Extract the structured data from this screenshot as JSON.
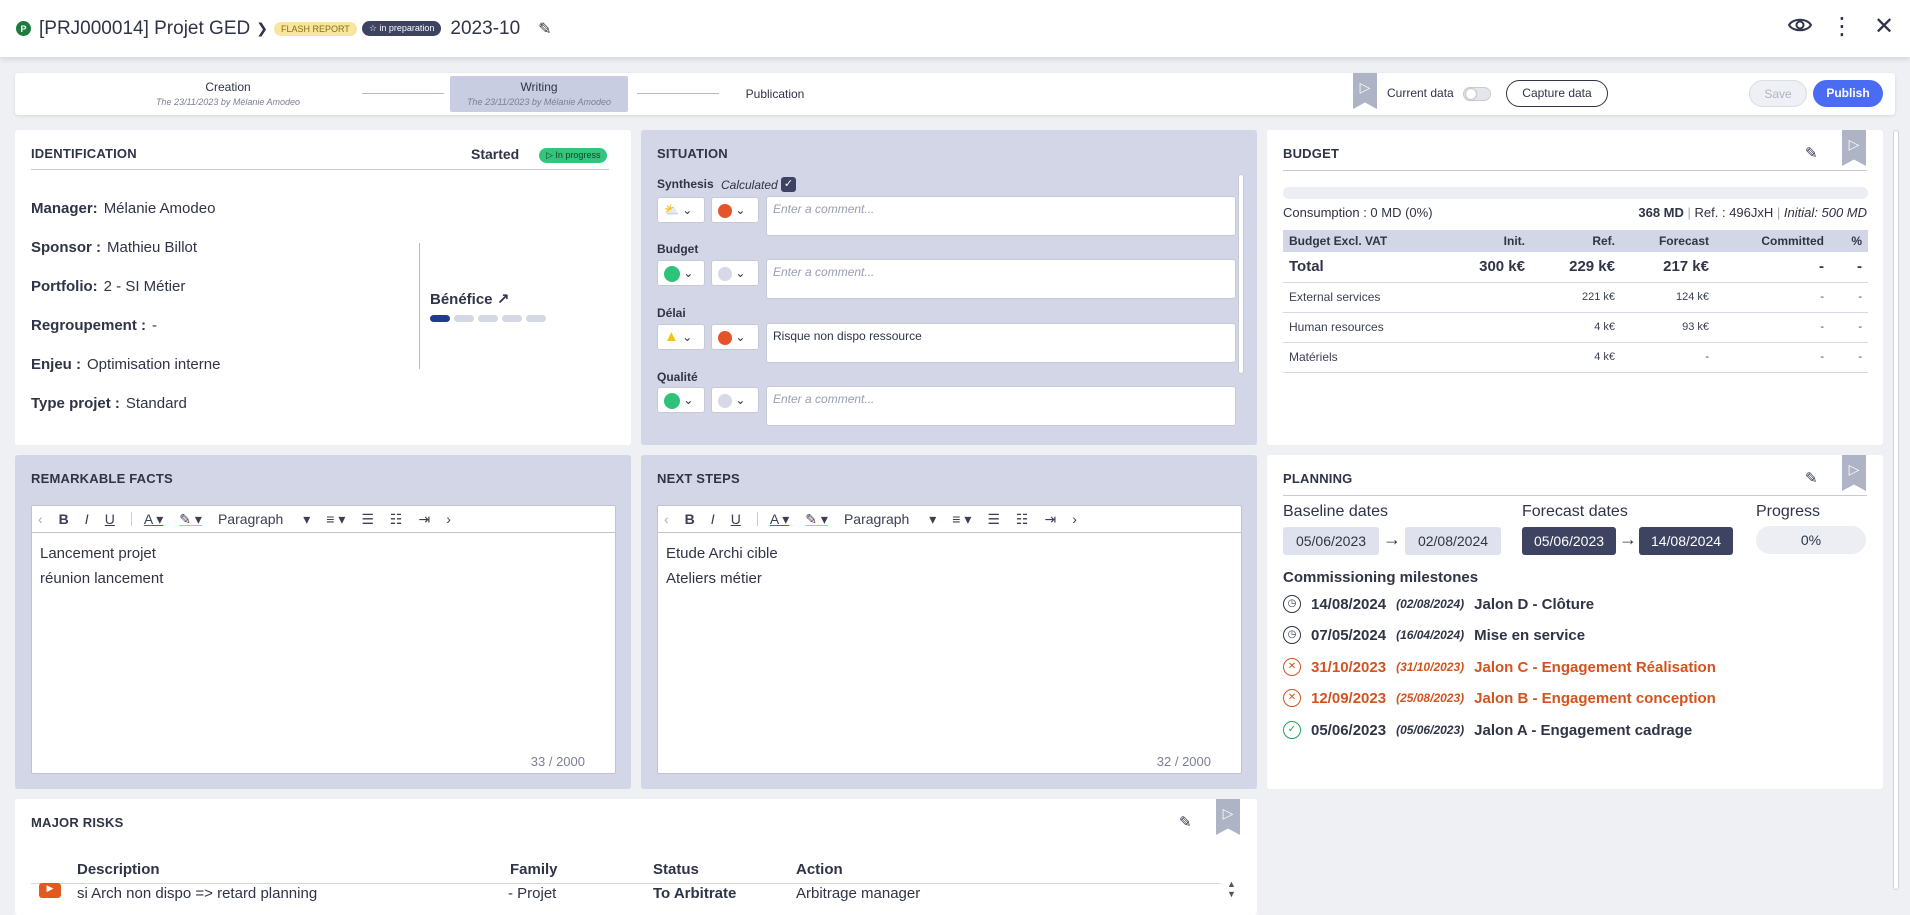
{
  "header": {
    "project_code": "[PRJ000014] Projet GED",
    "badge_flash": "FLASH REPORT",
    "badge_status": "☆ in preparation",
    "period": "2023-10",
    "p_letter": "P"
  },
  "workflow": {
    "steps": [
      {
        "name": "Creation",
        "date": "The 23/11/2023 by Mélanie Amodeo"
      },
      {
        "name": "Writing",
        "date": "The 23/11/2023 by Mélanie Amodeo"
      },
      {
        "name": "Publication",
        "date": ""
      }
    ],
    "current_data_label": "Current data",
    "capture_label": "Capture data",
    "save_label": "Save",
    "publish_label": "Publish"
  },
  "identification": {
    "title": "IDENTIFICATION",
    "state": "Started",
    "state_badge": "▷ In progress",
    "fields": [
      {
        "label": "Manager:",
        "value": "Mélanie Amodeo"
      },
      {
        "label": "Sponsor :",
        "value": "Mathieu Billot"
      },
      {
        "label": "Portfolio:",
        "value": "2 - SI Métier"
      },
      {
        "label": "Regroupement :",
        "value": "-"
      },
      {
        "label": "Enjeu :",
        "value": "Optimisation interne"
      },
      {
        "label": "Type projet :",
        "value": "Standard"
      }
    ],
    "benefit_label": "Bénéfice",
    "benefit_level": 1,
    "benefit_max": 5
  },
  "situation": {
    "title": "SITUATION",
    "synthesis_label": "Synthesis",
    "calculated_label": "Calculated",
    "rows": [
      {
        "label": "Budget",
        "comment": "",
        "placeholder": "Enter a comment..."
      },
      {
        "label": "Délai",
        "comment": "Risque non dispo ressource",
        "placeholder": "Enter a comment..."
      },
      {
        "label": "Qualité",
        "comment": "",
        "placeholder": "Enter a comment..."
      }
    ],
    "synthesis_placeholder": "Enter a comment..."
  },
  "budget": {
    "title": "BUDGET",
    "consumption": "Consumption : 0 MD (0%)",
    "md": "368 MD",
    "ref": "Ref. : 496JxH",
    "initial": "Initial: 500 MD",
    "columns": [
      "Budget Excl. VAT",
      "Init.",
      "Ref.",
      "Forecast",
      "Committed",
      "%"
    ],
    "rows": [
      [
        "Total",
        "300 k€",
        "229 k€",
        "217 k€",
        "-",
        "-"
      ],
      [
        "External services",
        "",
        "221 k€",
        "124 k€",
        "-",
        "-"
      ],
      [
        "Human resources",
        "",
        "4 k€",
        "93 k€",
        "-",
        "-"
      ],
      [
        "Matériels",
        "",
        "4 k€",
        "-",
        "-",
        "-"
      ]
    ]
  },
  "facts": {
    "title": "REMARKABLE FACTS",
    "lines": [
      "Lancement projet",
      "réunion lancement"
    ],
    "count": "33 / 2000",
    "paragraph": "Paragraph"
  },
  "next_steps": {
    "title": "NEXT STEPS",
    "lines": [
      "Etude Archi cible",
      "Ateliers métier"
    ],
    "count": "32 / 2000",
    "paragraph": "Paragraph"
  },
  "planning": {
    "title": "PLANNING",
    "baseline_label": "Baseline dates",
    "forecast_label": "Forecast dates",
    "progress_label": "Progress",
    "baseline_start": "05/06/2023",
    "baseline_end": "02/08/2024",
    "forecast_start": "05/06/2023",
    "forecast_end": "14/08/2024",
    "progress": "0%",
    "milestones_label": "Commissioning milestones",
    "milestones": [
      {
        "date": "14/08/2024",
        "planned": "(02/08/2024)",
        "name": "Jalon D - Clôture",
        "status": "pending"
      },
      {
        "date": "07/05/2024",
        "planned": "(16/04/2024)",
        "name": "Mise en service",
        "status": "pending"
      },
      {
        "date": "31/10/2023",
        "planned": "(31/10/2023)",
        "name": "Jalon C - Engagement Réalisation",
        "status": "late"
      },
      {
        "date": "12/09/2023",
        "planned": "(25/08/2023)",
        "name": "Jalon B - Engagement conception",
        "status": "late"
      },
      {
        "date": "05/06/2023",
        "planned": "(05/06/2023)",
        "name": "Jalon A - Engagement cadrage",
        "status": "done"
      }
    ]
  },
  "risks": {
    "title": "MAJOR RISKS",
    "columns": [
      "Description",
      "Family",
      "Status",
      "Action"
    ],
    "rows": [
      {
        "description": "si Arch non dispo => retard planning",
        "family": "- Projet",
        "status": "To Arbitrate",
        "action": "Arbitrage manager"
      }
    ]
  },
  "colors": {
    "accent": "#4a6cf2",
    "dark": "#3d4361",
    "panel_blue": "#d3d6e6",
    "late": "#d3531f",
    "done": "#1fa35c"
  }
}
